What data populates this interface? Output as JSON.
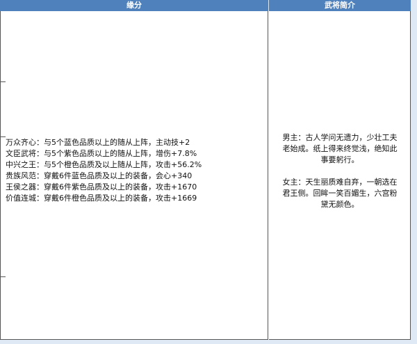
{
  "table": {
    "headers": {
      "bonds": "缘分",
      "intro": "武将简介"
    },
    "bonds": [
      "万众齐心：与5个蓝色品质以上的随从上阵，主动技+2",
      "文臣武将：与5个紫色品质以上的随从上阵，增伤+7.8%",
      "中兴之王：与5个橙色品质及以上随从上阵，攻击+56.2%",
      "贵族风范：穿戴6件蓝色品质及以上的装备，会心+340",
      "王侯之器：穿戴6件紫色品质及以上的装备，攻击+1670",
      "价值连城：穿戴6件橙色品质及以上的装备，攻击+1669"
    ],
    "intro": {
      "male": [
        "男主：古人学问无遗力，少壮工夫",
        "老始成。纸上得来终觉浅，绝知此",
        "事要躬行。"
      ],
      "female": [
        "女主：天生丽质难自弃，一朝选在",
        "君王侧。回眸一笑百媚生，六宫粉",
        "黛无颜色。"
      ]
    }
  }
}
